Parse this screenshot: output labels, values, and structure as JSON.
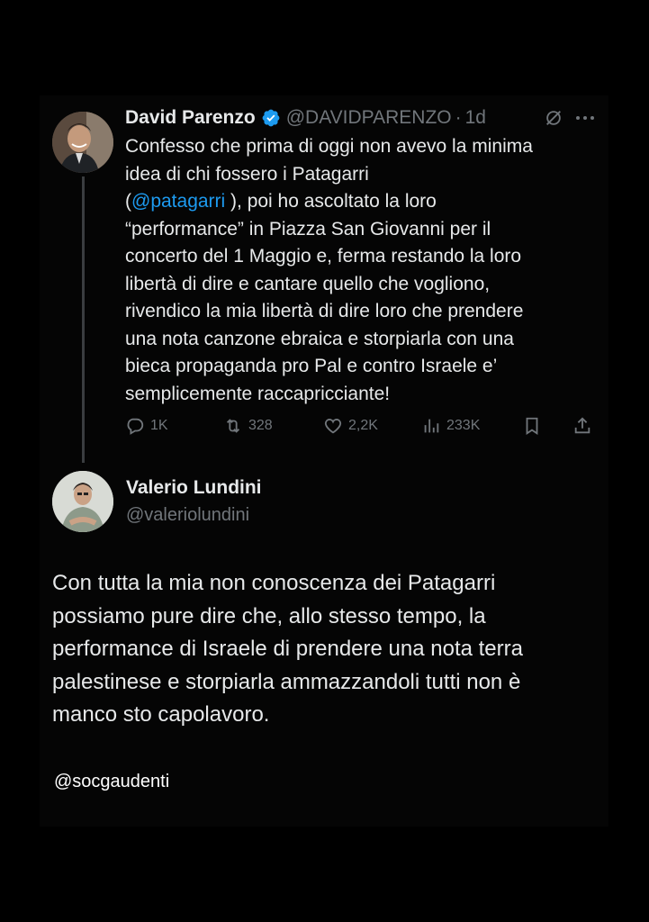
{
  "tweet1": {
    "author_name": "David Parenzo",
    "handle": "@DAVIDPARENZO",
    "separator": "·",
    "time": "1d",
    "text_lines": [
      "Confesso che prima di oggi non avevo la minima",
      "idea di chi fossero i Patagarri",
      "(",
      "@patagarri",
      " ), poi ho ascoltato la loro",
      "“performance” in Piazza San Giovanni per il",
      "concerto del 1 Maggio e, ferma restando la loro",
      "libertà di dire e cantare quello che vogliono,",
      "rivendico la mia libertà di dire loro che prendere",
      "una nota canzone ebraica e storpiarla con una",
      "bieca propaganda pro Pal e contro Israele e’",
      "semplicemente raccapricciante!"
    ],
    "actions": {
      "replies": "1K",
      "reposts": "328",
      "likes": "2,2K",
      "views": "233K"
    },
    "icons": {
      "verified": "verified-badge-icon",
      "grok": "grok-icon",
      "more": "more-options-icon",
      "reply": "reply-icon",
      "repost": "repost-icon",
      "like": "heart-icon",
      "views": "views-chart-icon",
      "bookmark": "bookmark-icon",
      "share": "share-icon"
    }
  },
  "tweet2": {
    "author_name": "Valerio Lundini",
    "handle": "@valeriolundini",
    "text_lines": [
      "Con tutta la mia non conoscenza dei Patagarri",
      "possiamo pure dire che, allo stesso tempo, la",
      "performance di Israele di prendere una nota terra",
      "palestinese e storpiarla ammazzandoli tutti non è",
      "manco sto capolavoro."
    ]
  },
  "watermark": "@socgaudenti",
  "colors": {
    "background": "#000000",
    "text": "#e7e9ea",
    "muted": "#71767b",
    "accent": "#1d9bf0"
  }
}
